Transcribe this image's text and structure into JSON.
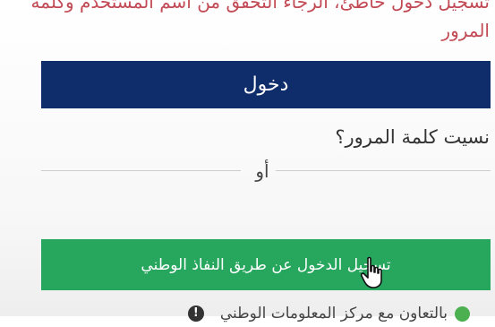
{
  "error": {
    "message": "تسجيل دخول خاطئ، الرجاء التحقق من اسم المستخدم وكلمة المرور"
  },
  "login": {
    "label": "دخول"
  },
  "forgot": {
    "label": "نسيت كلمة المرور؟"
  },
  "divider": {
    "label": "أو"
  },
  "nafath": {
    "label": "تسجيل الدخول عن طريق النفاذ الوطني"
  },
  "footer": {
    "text": "بالتعاون مع مركز المعلومات الوطني",
    "info_icon_glyph": "!"
  },
  "colors": {
    "error": "#c24a55",
    "login_button": "#0f2d6b",
    "nafath_button": "#27a65e"
  }
}
